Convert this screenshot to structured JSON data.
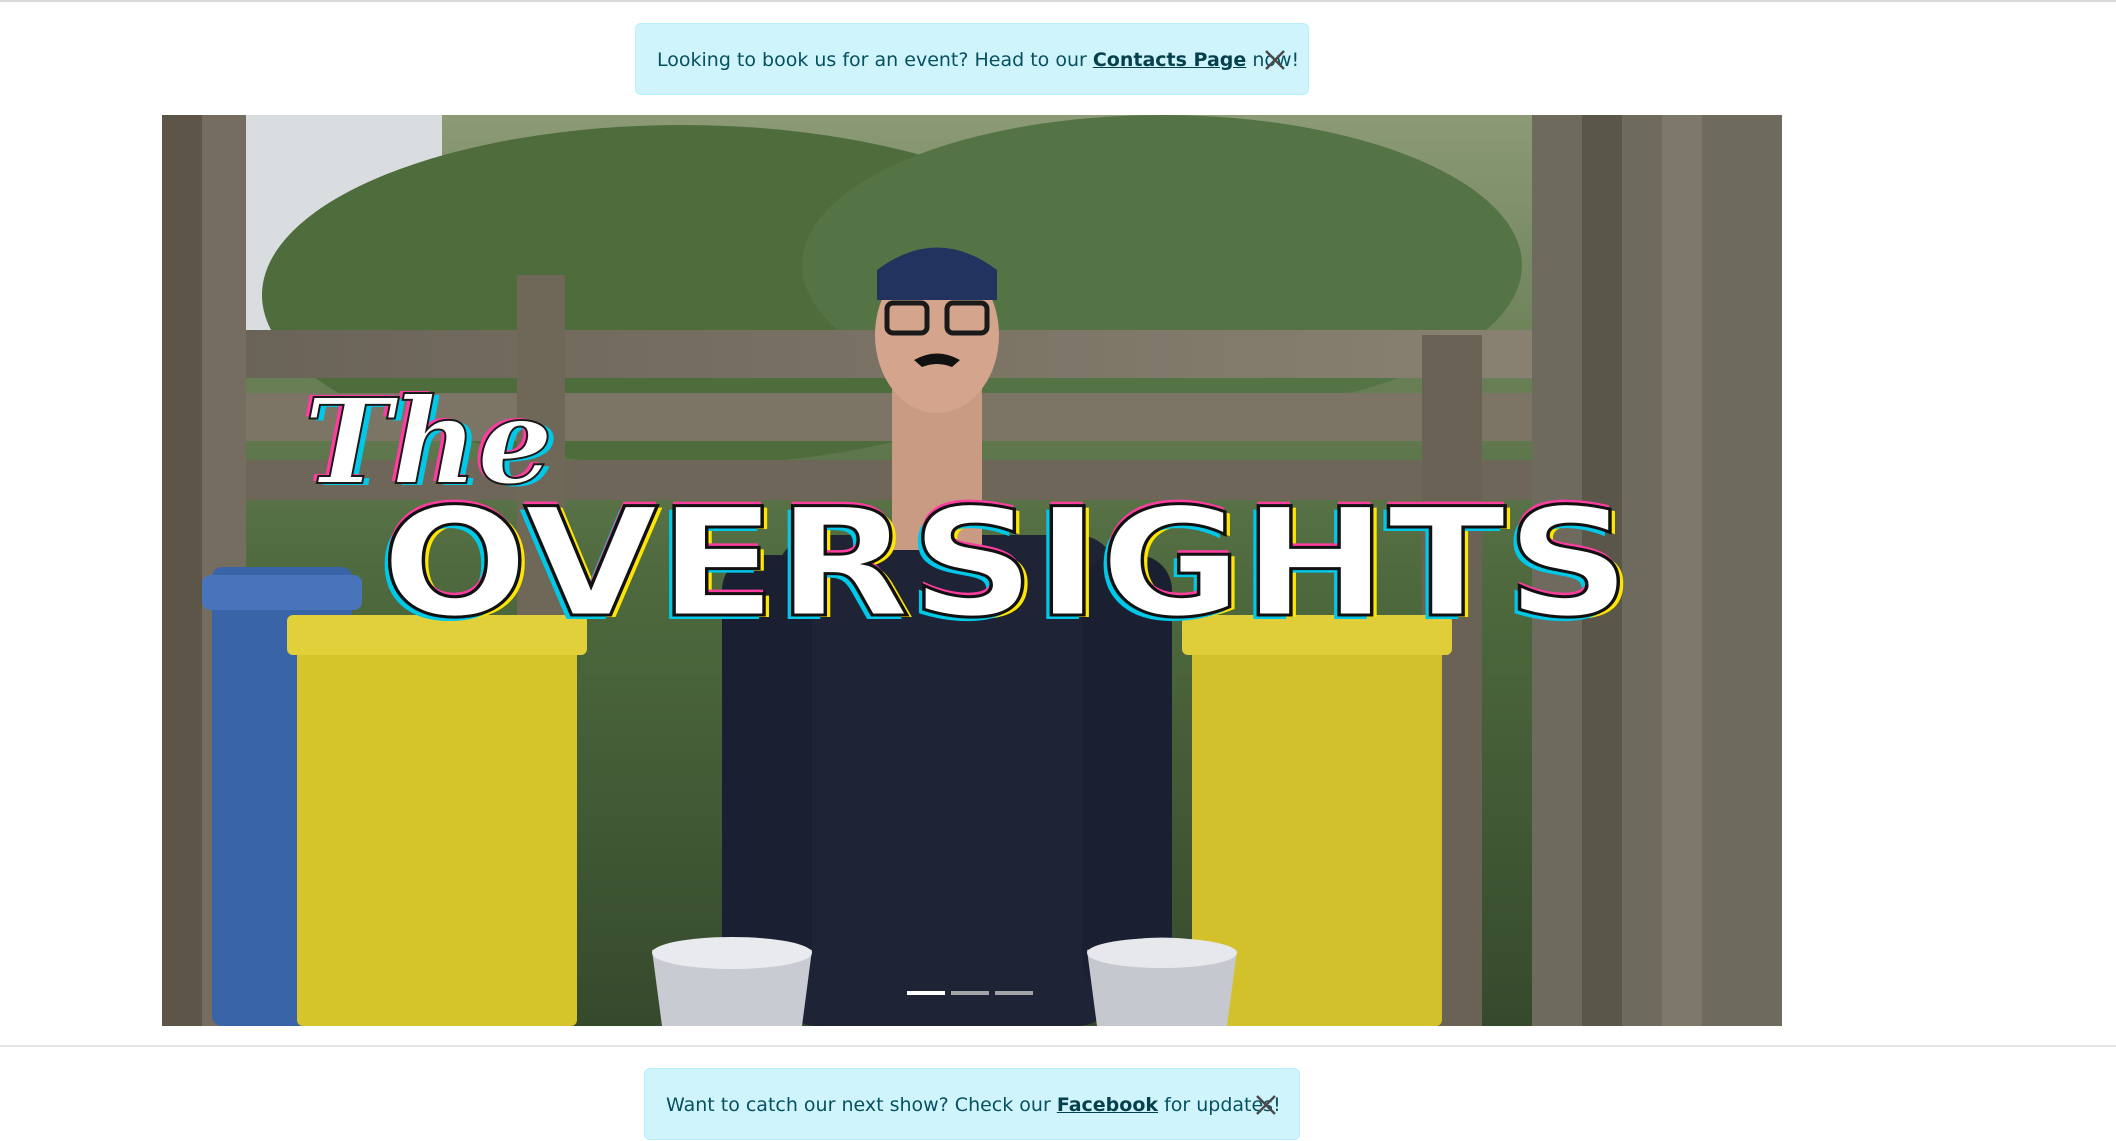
{
  "top_alert": {
    "text_before": "Looking to book us for an event? Head to our",
    "link_text": "Contacts Page",
    "text_after": "now!",
    "close_icon": "close-icon"
  },
  "hero": {
    "logo_script": "The",
    "logo_title": "OVERSIGHTS",
    "slide_count": 3,
    "active_slide": 1
  },
  "bottom_alert": {
    "text_before": "Want to catch our next show? Check our",
    "link_text": "Facebook",
    "text_after": "for updates!",
    "close_icon": "close-icon"
  },
  "colors": {
    "alert_bg": "#cff4fc",
    "alert_text": "#055160",
    "bin_blue": "#3a64a8",
    "bin_yellow": "#d6c42b",
    "overall_navy": "#1e2436"
  }
}
